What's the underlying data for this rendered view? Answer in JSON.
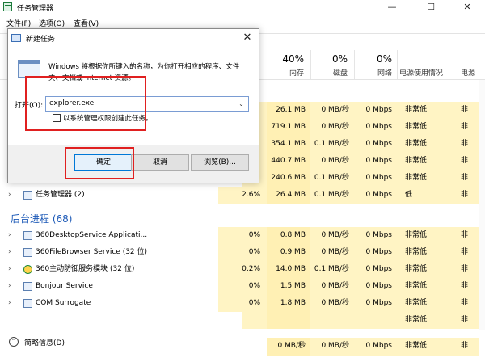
{
  "window": {
    "title": "任务管理器"
  },
  "window_buttons": {
    "min": "—",
    "max": "☐",
    "close": "✕"
  },
  "menu": [
    "文件(F)",
    "选项(O)",
    "查看(V)"
  ],
  "columns": [
    {
      "pct": "40%",
      "name": "内存"
    },
    {
      "pct": "0%",
      "name": "磁盘"
    },
    {
      "pct": "0%",
      "name": "网络"
    },
    {
      "pct": "",
      "name": "电源使用情况"
    },
    {
      "pct": "",
      "name": "电源"
    }
  ],
  "rows_top": [
    {
      "cpu": "",
      "mem": "26.1 MB",
      "disk": "0 MB/秒",
      "net": "0 Mbps",
      "pow": "非常低",
      "trend": "非"
    },
    {
      "cpu": "",
      "mem": "719.1 MB",
      "disk": "0 MB/秒",
      "net": "0 Mbps",
      "pow": "非常低",
      "trend": "非"
    },
    {
      "cpu": "",
      "mem": "354.1 MB",
      "disk": "0.1 MB/秒",
      "net": "0 Mbps",
      "pow": "非常低",
      "trend": "非"
    },
    {
      "cpu": "",
      "mem": "440.7 MB",
      "disk": "0 MB/秒",
      "net": "0 Mbps",
      "pow": "非常低",
      "trend": "非"
    },
    {
      "cpu": "",
      "mem": "240.6 MB",
      "disk": "0.1 MB/秒",
      "net": "0 Mbps",
      "pow": "非常低",
      "trend": "非"
    }
  ],
  "task_manager_row": {
    "name": "任务管理器 (2)",
    "cpu": "2.6%",
    "mem": "26.4 MB",
    "disk": "0.1 MB/秒",
    "net": "0 Mbps",
    "pow": "低",
    "trend": "非"
  },
  "background_group": {
    "title": "后台进程 (68)"
  },
  "background_rows": [
    {
      "name": "360DesktopService Applicati...",
      "cpu": "0%",
      "mem": "0.8 MB",
      "disk": "0 MB/秒",
      "net": "0 Mbps",
      "pow": "非常低",
      "trend": "非"
    },
    {
      "name": "360FileBrowser Service (32 位)",
      "cpu": "0%",
      "mem": "0.9 MB",
      "disk": "0 MB/秒",
      "net": "0 Mbps",
      "pow": "非常低",
      "trend": "非"
    },
    {
      "name": "360主动防御服务模块 (32 位)",
      "cpu": "0.2%",
      "mem": "14.0 MB",
      "disk": "0.1 MB/秒",
      "net": "0 Mbps",
      "pow": "非常低",
      "trend": "非"
    },
    {
      "name": "Bonjour Service",
      "cpu": "0%",
      "mem": "1.5 MB",
      "disk": "0 MB/秒",
      "net": "0 Mbps",
      "pow": "非常低",
      "trend": "非"
    },
    {
      "name": "COM Surrogate",
      "cpu": "0%",
      "mem": "1.8 MB",
      "disk": "0 MB/秒",
      "net": "0 Mbps",
      "pow": "非常低",
      "trend": "非"
    }
  ],
  "partial_rows": [
    {
      "pow": "非常低",
      "trend": "非"
    },
    {
      "mem": "0 MB/秒",
      "disk": "0 MB/秒",
      "net": "0 Mbps",
      "pow": "非常低",
      "trend": "非"
    }
  ],
  "footer": {
    "fewer_details": "简略信息(D)",
    "fewer_icon": "⌃"
  },
  "run_dialog": {
    "title": "新建任务",
    "close": "✕",
    "description": "Windows 将根据你所键入的名称，为你打开相应的程序、文件夹、文档或 Internet 资源。",
    "open_label": "打开(O):",
    "input_value": "explorer.exe",
    "dropdown_icon": "⌄",
    "admin_label": "以系统管理权限创建此任务。",
    "ok": "确定",
    "cancel": "取消",
    "browse": "浏览(B)..."
  },
  "colors": {
    "accent": "#1c59b7",
    "highlight": "#e02020",
    "heat": "#fff4c4"
  }
}
